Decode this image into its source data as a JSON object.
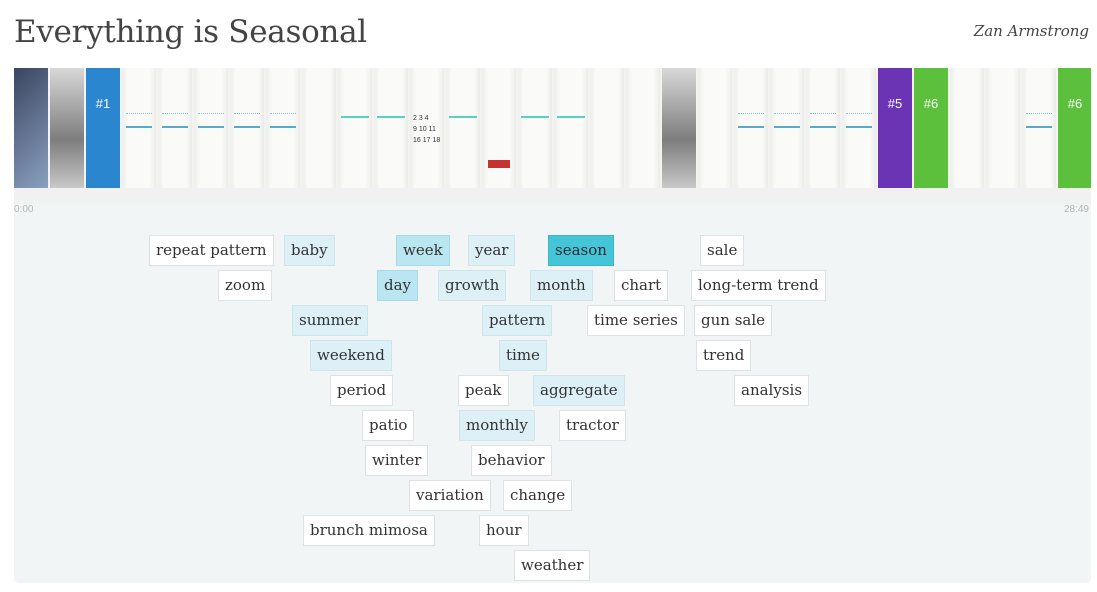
{
  "header": {
    "title": "Everything is Seasonal",
    "author": "Zan Armstrong"
  },
  "timeline": {
    "start": "0:00",
    "end": "28:49"
  },
  "slides": [
    {
      "label": "",
      "style": "dark"
    },
    {
      "label": "",
      "style": "photo"
    },
    {
      "label": "#1",
      "style": "blue"
    },
    {
      "label": "",
      "style": "spark"
    },
    {
      "label": "",
      "style": "spark"
    },
    {
      "label": "",
      "style": "spark"
    },
    {
      "label": "",
      "style": "spark"
    },
    {
      "label": "",
      "style": "spark"
    },
    {
      "label": "",
      "style": ""
    },
    {
      "label": "",
      "style": "teal"
    },
    {
      "label": "",
      "style": "teal"
    },
    {
      "label": "",
      "style": "cal"
    },
    {
      "label": "",
      "style": "teal"
    },
    {
      "label": "",
      "style": "red"
    },
    {
      "label": "",
      "style": "teal"
    },
    {
      "label": "",
      "style": "teal"
    },
    {
      "label": "",
      "style": ""
    },
    {
      "label": "",
      "style": ""
    },
    {
      "label": "",
      "style": "photo"
    },
    {
      "label": "",
      "style": ""
    },
    {
      "label": "",
      "style": "spark"
    },
    {
      "label": "",
      "style": "spark"
    },
    {
      "label": "",
      "style": "spark"
    },
    {
      "label": "",
      "style": "spark"
    },
    {
      "label": "#5",
      "style": "purple"
    },
    {
      "label": "#6",
      "style": "green"
    },
    {
      "label": "",
      "style": ""
    },
    {
      "label": "",
      "style": ""
    },
    {
      "label": "",
      "style": "spark"
    },
    {
      "label": "#6",
      "style": "green"
    }
  ],
  "tags": [
    {
      "text": "repeat pattern",
      "level": 0
    },
    {
      "text": "baby",
      "level": 1
    },
    {
      "text": "week",
      "level": 2
    },
    {
      "text": "year",
      "level": 1
    },
    {
      "text": "season",
      "level": 3
    },
    {
      "text": "sale",
      "level": 0
    },
    {
      "text": "zoom",
      "level": 0
    },
    {
      "text": "day",
      "level": 2
    },
    {
      "text": "growth",
      "level": 1
    },
    {
      "text": "month",
      "level": 1
    },
    {
      "text": "chart",
      "level": 0
    },
    {
      "text": "long-term trend",
      "level": 0
    },
    {
      "text": "summer",
      "level": 1
    },
    {
      "text": "pattern",
      "level": 1
    },
    {
      "text": "time series",
      "level": 0
    },
    {
      "text": "gun sale",
      "level": 0
    },
    {
      "text": "weekend",
      "level": 1
    },
    {
      "text": "time",
      "level": 1
    },
    {
      "text": "trend",
      "level": 0
    },
    {
      "text": "period",
      "level": 0
    },
    {
      "text": "peak",
      "level": 0
    },
    {
      "text": "aggregate",
      "level": 1
    },
    {
      "text": "analysis",
      "level": 0
    },
    {
      "text": "patio",
      "level": 0
    },
    {
      "text": "monthly",
      "level": 1
    },
    {
      "text": "tractor",
      "level": 0
    },
    {
      "text": "winter",
      "level": 0
    },
    {
      "text": "behavior",
      "level": 0
    },
    {
      "text": "variation",
      "level": 0
    },
    {
      "text": "change",
      "level": 0
    },
    {
      "text": "brunch mimosa",
      "level": 0
    },
    {
      "text": "hour",
      "level": 0
    },
    {
      "text": "weather",
      "level": 0
    }
  ]
}
